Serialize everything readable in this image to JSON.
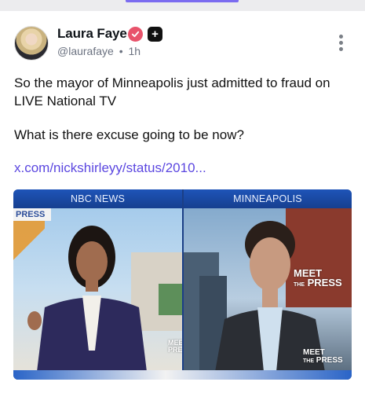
{
  "post": {
    "author_name": "Laura Faye",
    "handle": "@laurafaye",
    "separator": "•",
    "time": "1h",
    "text_lines": [
      "So the mayor of Minneapolis just admitted to fraud on",
      "LIVE National TV",
      "What is there excuse going to be now?"
    ],
    "link": "x.com/nickshirleyy/status/2010..."
  },
  "video": {
    "left_label": "NBC NEWS",
    "right_label": "MINNEAPOLIS",
    "press_tag": "PRESS",
    "badge_meet": "MEET",
    "badge_the": "THE",
    "badge_press": "PRESS",
    "badge_small_meet": "MEET",
    "badge_small_the": "THE",
    "badge_small_press": "PRESS",
    "badge_edge_meet": "MEET",
    "badge_edge_press": "PRE"
  },
  "colors": {
    "accent": "#7b6cf0",
    "link": "#5b47e0",
    "verified": "#e8536b"
  },
  "icons": [
    "verified-badge-icon",
    "plus-icon",
    "more-vertical-icon"
  ]
}
